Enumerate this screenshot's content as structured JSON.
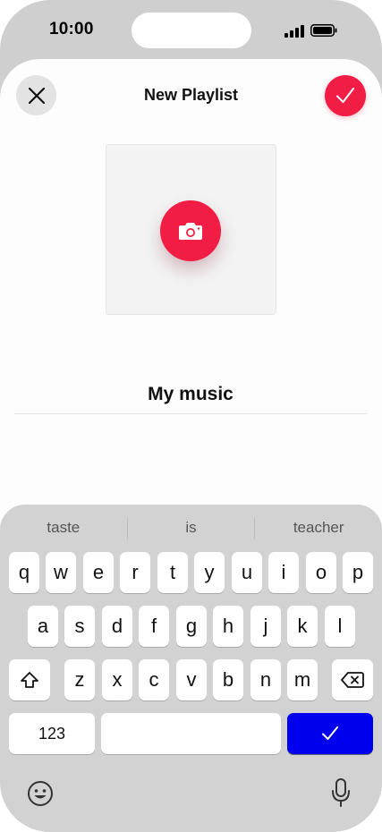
{
  "status_bar": {
    "time": "10:00",
    "signal_icon": "cellular-signal-icon",
    "battery_icon": "battery-icon"
  },
  "header": {
    "title": "New Playlist",
    "close_icon": "close-icon",
    "confirm_icon": "checkmark-icon"
  },
  "artwork": {
    "camera_icon": "camera-icon"
  },
  "playlist_name": {
    "value": "My music"
  },
  "keyboard": {
    "suggestions": [
      "taste",
      "is",
      "teacher"
    ],
    "row1": [
      "q",
      "w",
      "e",
      "r",
      "t",
      "y",
      "u",
      "i",
      "o",
      "p"
    ],
    "row2": [
      "a",
      "s",
      "d",
      "f",
      "g",
      "h",
      "j",
      "k",
      "l"
    ],
    "row3": [
      "z",
      "x",
      "c",
      "v",
      "b",
      "n",
      "m"
    ],
    "numbers_label": "123",
    "shift_icon": "shift-icon",
    "delete_icon": "delete-backspace-icon",
    "return_icon": "checkmark-icon",
    "emoji_icon": "emoji-icon",
    "mic_icon": "microphone-icon"
  },
  "colors": {
    "accent": "#f21d45",
    "return_key": "#0000ee",
    "keyboard_bg": "#d2d2d2"
  }
}
